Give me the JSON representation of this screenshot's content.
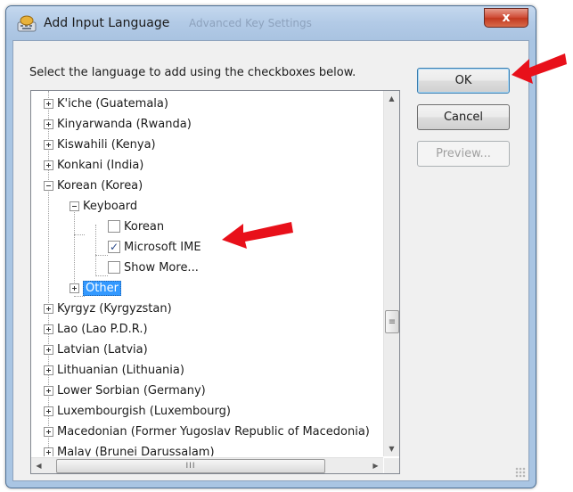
{
  "dialog": {
    "title": "Add Input Language",
    "ghost_title": "Advanced Key Settings",
    "close_label": "x",
    "instruction": "Select the language to add using the checkboxes below."
  },
  "buttons": {
    "ok": "OK",
    "cancel": "Cancel",
    "preview": "Preview..."
  },
  "tree": {
    "items_before": [
      "K'iche (Guatemala)",
      "Kinyarwanda (Rwanda)",
      "Kiswahili (Kenya)",
      "Konkani (India)"
    ],
    "expanded_language": "Korean (Korea)",
    "keyboard_label": "Keyboard",
    "keyboard_options": [
      {
        "label": "Korean",
        "checked": false
      },
      {
        "label": "Microsoft IME",
        "checked": true
      },
      {
        "label": "Show More...",
        "checked": false
      }
    ],
    "other_label": "Other",
    "items_after": [
      "Kyrgyz (Kyrgyzstan)",
      "Lao (Lao P.D.R.)",
      "Latvian (Latvia)",
      "Lithuanian (Lithuania)",
      "Lower Sorbian (Germany)",
      "Luxembourgish (Luxembourg)",
      "Macedonian (Former Yugoslav Republic of Macedonia)",
      "Malay (Brunei Darussalam)"
    ]
  },
  "scrollbar": {
    "up_glyph": "▲",
    "down_glyph": "▼",
    "left_glyph": "◀",
    "right_glyph": "▶",
    "grip_glyph": "≡",
    "hgrip_glyph": "III"
  },
  "colors": {
    "selection": "#3399ff",
    "annotation_arrow": "#e8101a",
    "titlebar": "#b2cae6"
  }
}
